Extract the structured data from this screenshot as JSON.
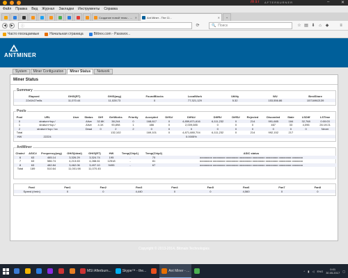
{
  "desktop": {
    "brand": "msi",
    "brand_sub": "AFTERBURNER"
  },
  "browser": {
    "menu": [
      "Файл",
      "Правка",
      "Вид",
      "Журнал",
      "Закладки",
      "Инструменты",
      "Справка"
    ],
    "tabs": [
      {
        "label": "",
        "icon_color": "#f4a300"
      },
      {
        "label": "",
        "icon_color": "#2a7de1"
      },
      {
        "label": "",
        "icon_color": "#333333"
      },
      {
        "label": "",
        "icon_color": "#f7931a"
      },
      {
        "label": "",
        "icon_color": "#1da1f2"
      },
      {
        "label": "",
        "icon_color": "#f7931a"
      },
      {
        "label": "",
        "icon_color": "#4caf50"
      },
      {
        "label": "",
        "icon_color": "#2a7de1"
      },
      {
        "label": "",
        "icon_color": "#e53935"
      },
      {
        "label": "",
        "icon_color": "#f7931a"
      },
      {
        "label": "Создание новой темы - Bit...",
        "icon_color": "#f7931a"
      },
      {
        "label": "Ant Miner - The Cl...",
        "icon_color": "#005f9a",
        "active": true
      }
    ],
    "url": "",
    "search_placeholder": "Поиск",
    "bookmarks": [
      {
        "label": "Часто посещаемые",
        "icon_color": "#f4a300"
      },
      {
        "label": "Начальная страница",
        "icon_color": "#e76f00"
      },
      {
        "label": "Bittrex.com - Passwor...",
        "icon_color": "#2a7de1"
      }
    ]
  },
  "antminer": {
    "logo": "ANTMINER",
    "nav": [
      "System",
      "Miner Configuration",
      "Miner Status",
      "Network"
    ],
    "title": "Miner Status",
    "summary": {
      "legend": "Summary",
      "headers": [
        "Elapsed",
        "GH/S(RT)",
        "GH/S(avg)",
        "FoundBlocks",
        "LocalWork",
        "Utility",
        "WU",
        "BestShare"
      ],
      "row": [
        "22d1h27m6s",
        "11,070.44",
        "11,028.73",
        "0",
        "77,321,129",
        "5.32",
        "153,556.86",
        "15716962139"
      ]
    },
    "pools": {
      "legend": "Pools",
      "headers": [
        "Pool",
        "URL",
        "User",
        "Status",
        "Diff",
        "GetWorks",
        "Priority",
        "Accepted",
        "Diff1#",
        "DiffA#",
        "DiffR#",
        "DiffS#",
        "Rejected",
        "Discarded",
        "Stale",
        "LSDiff",
        "LSTime"
      ],
      "rows": [
        [
          "0",
          "stratum+tcp:/",
          "",
          "Alive",
          "32.8K",
          "38,244",
          "0",
          "168,617",
          "0",
          "4,859,871,616",
          "6,111,232",
          "0",
          "214",
          "991,685",
          "184",
          "32,768",
          "0:00:03"
        ],
        [
          "1",
          "stratum+tcp:/",
          "",
          "Alive",
          "4.1K",
          "90,898",
          "1",
          "486",
          "0",
          "2,009,085",
          "0",
          "0",
          "0",
          "467",
          "33",
          "4,096",
          "26:19:21"
        ],
        [
          "2",
          "stratum+tcp:/ /cx",
          "",
          "Dead",
          "0",
          "2",
          "2",
          "0",
          "0",
          "0",
          "0",
          "0",
          "0",
          "0",
          "0",
          "0",
          "Never"
        ],
        [
          "Total",
          "",
          "",
          "",
          "",
          "132,102",
          "",
          "169,101",
          "0",
          "4,871,880,704",
          "6,111,232",
          "0",
          "214",
          "992,152",
          "217",
          "",
          ""
        ],
        [
          "HW",
          "22224",
          "",
          "",
          "",
          "",
          "",
          "",
          "",
          "0.0005%",
          "",
          "",
          "",
          "",
          "",
          "",
          ""
        ]
      ]
    },
    "antminer_status": {
      "legend": "AntMiner",
      "headers": [
        "Chain#",
        "ASIC#",
        "Frequency(avg)",
        "GH/S(ideal)",
        "GH/S(RT)",
        "HW",
        "Temp(Chip1)",
        "Temp(Chip2)",
        "ASIC status"
      ],
      "rows": [
        [
          "6",
          "63",
          "465.14",
          "3,326.29",
          "3,324.74",
          "195",
          "-",
          "70",
          "oooooooo oooooooo oooooooo oooooooo oooooooo oooooooo oooooooo ooooooo"
        ],
        [
          "7",
          "63",
          "586.74",
          "4,213.63",
          "4,288.61",
          "12518",
          "-",
          "81",
          "oooooooo oooooooo oooooooo oooooooo oooooooo oooooooo oooooooo ooooooo"
        ],
        [
          "8",
          "63",
          "482.84",
          "3,462.06",
          "3,497.10",
          "9495",
          "-",
          "67",
          "oooooooo oooooooo oooooooo oooooooo oooooooo oooooooo oooooooo ooooooo"
        ],
        [
          "Total",
          "189",
          "510.64",
          "11,001.98",
          "11,070.45",
          "",
          "",
          "",
          ""
        ]
      ]
    },
    "fans": {
      "headers": [
        "Fan#",
        "Fan1",
        "Fan2",
        "Fan3",
        "Fan4",
        "Fan5",
        "Fan6",
        "Fan7",
        "Fan8"
      ],
      "row": [
        "Speed (r/min)",
        "0",
        "0",
        "4,440",
        "0",
        "0",
        "4,560",
        "0",
        "0"
      ]
    },
    "footer": "Copyright © 2013-2014, Bitmain Technologies"
  },
  "taskbar": {
    "items": [
      {
        "label": "",
        "icon_color": "#3c7bd4"
      },
      {
        "label": "",
        "icon_color": "#f4b400"
      },
      {
        "label": "",
        "icon_color": "#2a7de1"
      },
      {
        "label": "",
        "icon_color": "#8a2be2"
      },
      {
        "label": "",
        "icon_color": "#c33"
      },
      {
        "label": "",
        "icon_color": "#e67e22"
      },
      {
        "label": "MSI Afterburn...",
        "icon_color": "#c33"
      },
      {
        "label": "Skype™ - the...",
        "icon_color": "#00aff0"
      },
      {
        "label": "",
        "icon_color": "#e84f1c"
      },
      {
        "label": "Ant Miner - ...",
        "icon_color": "#e76f00",
        "active": true
      },
      {
        "label": "",
        "icon_color": "#4caf50"
      }
    ],
    "lang": "ENG",
    "time": "0:01",
    "date": "30.05.2017"
  }
}
